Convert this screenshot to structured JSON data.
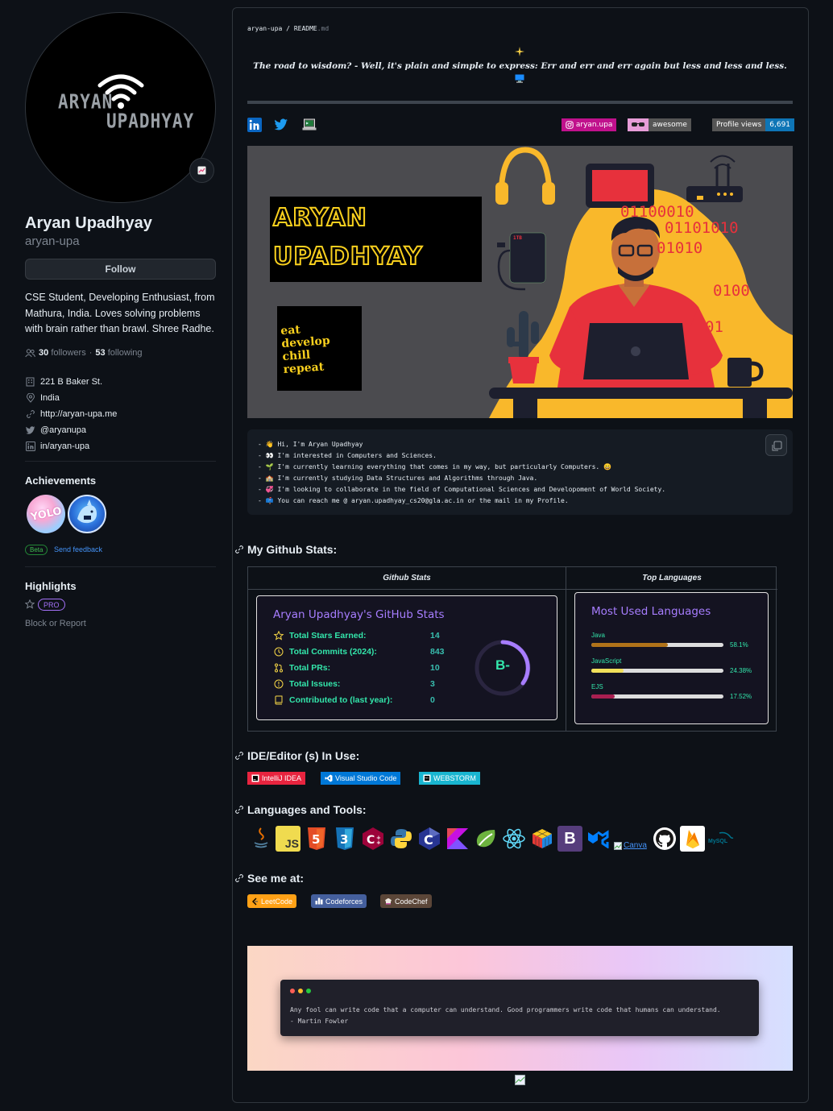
{
  "profile": {
    "avatar_text_1": "ARYAN",
    "avatar_text_2": "UPADHYAY",
    "name": "Aryan Upadhyay",
    "login": "aryan-upa",
    "follow_label": "Follow",
    "bio": "CSE Student, Developing Enthusiast, from Mathura, India. Loves solving problems with brain rather than brawl. Shree Radhe.",
    "followers_count": "30",
    "followers_label": "followers",
    "following_count": "53",
    "following_label": "following",
    "separator": "·",
    "details": [
      {
        "icon": "building-icon",
        "text": "221 B Baker St."
      },
      {
        "icon": "location-icon",
        "text": "India"
      },
      {
        "icon": "link-icon",
        "text": "http://aryan-upa.me"
      },
      {
        "icon": "twitter-icon",
        "text": "@aryanupa"
      },
      {
        "icon": "linkedin-icon",
        "text": "in/aryan-upa"
      }
    ],
    "achievements_title": "Achievements",
    "achievement_1_text": "YOLO",
    "beta_label": "Beta",
    "feedback_label": "Send feedback",
    "highlights_title": "Highlights",
    "pro_label": "PRO",
    "block_label": "Block or Report"
  },
  "readme": {
    "crumb_user": "aryan-upa",
    "crumb_sep": " / ",
    "crumb_file": "README",
    "crumb_ext": ".md",
    "quote": "The road to wisdom? - Well, it's plain and simple to express: Err and err and err again but less and less and less.",
    "shields": {
      "instagram": "aryan.upa",
      "awesome": "awesome",
      "views_label": "Profile views",
      "views_value": "6,691"
    },
    "banner": {
      "title_1": "ARYAN",
      "title_2": "UPADHYAY",
      "motto": [
        "eat",
        "develop",
        "chill",
        "repeat"
      ],
      "binary": [
        "01100010",
        "01101010",
        "01010",
        "0100",
        "01"
      ],
      "drive_label": "1TB"
    },
    "intro_lines": [
      "Hi, I'm Aryan Upadhyay",
      "I'm interested in Computers and Sciences.",
      "I'm currently learning everything that comes in my way, but particularly Computers. 😄",
      "I'm currently studying Data Structures and Algorithms through Java.",
      "I'm looking to collaborate in the field of Computational Sciences and Developoment of World Society.",
      "You can reach me @ aryan.upadhyay_cs20@gla.ac.in or the mail in my Profile."
    ],
    "intro_bullet": "-",
    "stats_heading": "My Github Stats:",
    "col_stats": "Github Stats",
    "col_langs": "Top Languages",
    "stats_card": {
      "title": "Aryan Upadhyay's GitHub Stats",
      "rows": [
        {
          "label": "Total Stars Earned:",
          "value": "14"
        },
        {
          "label": "Total Commits (2024):",
          "value": "843"
        },
        {
          "label": "Total PRs:",
          "value": "10"
        },
        {
          "label": "Total Issues:",
          "value": "3"
        },
        {
          "label": "Contributed to (last year):",
          "value": "0"
        }
      ],
      "grade": "B-"
    },
    "langs_card": {
      "title": "Most Used Languages",
      "langs": [
        {
          "name": "Java",
          "percent": "58.1%",
          "value": 58.1,
          "color": "#b07219"
        },
        {
          "name": "JavaScript",
          "percent": "24.38%",
          "value": 24.38,
          "color": "#f1e05a"
        },
        {
          "name": "EJS",
          "percent": "17.52%",
          "value": 17.52,
          "color": "#a91e50"
        }
      ]
    },
    "ide_heading": "IDE/Editor (s) In Use:",
    "ides": [
      "IntelliJ IDEA",
      "Visual Studio Code",
      "WEBSTORM"
    ],
    "tools_heading": "Languages and Tools:",
    "tools_canva": "Canva",
    "tools_mysql": "MySQL",
    "see_heading": "See me at:",
    "platforms": [
      "LeetCode",
      "Codeforces",
      "CodeChef"
    ],
    "quote_block": "Any fool can write code that a computer can understand. Good programmers write code that humans can understand.",
    "quote_author": "- Martin Fowler"
  },
  "colors": {
    "accent_blue": "#4493f8",
    "card_title": "#a77dff",
    "stat_text": "#33e6ab"
  }
}
